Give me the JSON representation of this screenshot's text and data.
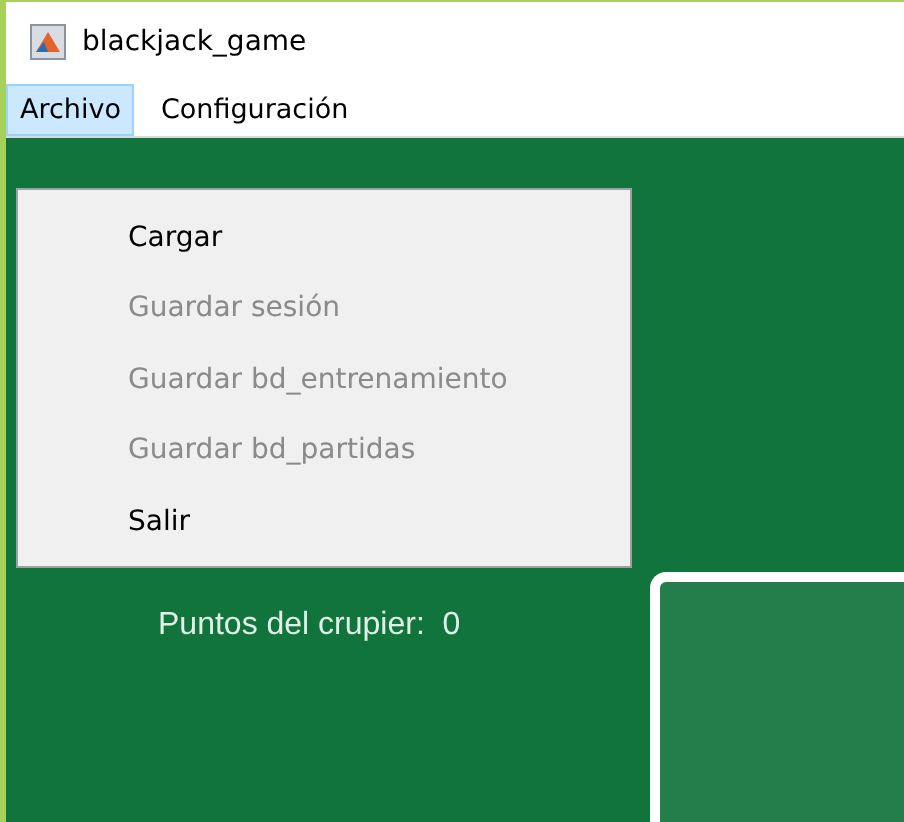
{
  "window": {
    "title": "blackjack_game"
  },
  "menu_bar": [
    {
      "label": "Archivo",
      "selected": true
    },
    {
      "label": "Configuración",
      "selected": false
    }
  ],
  "menu": {
    "items": [
      {
        "label": "Cargar",
        "disabled": false
      },
      {
        "label": "Guardar sesión",
        "disabled": true
      },
      {
        "label": "Guardar bd_entrenamiento",
        "disabled": true
      },
      {
        "label": "Guardar bd_partidas",
        "disabled": true
      },
      {
        "label": "Salir",
        "disabled": false
      }
    ]
  },
  "game": {
    "dealer_points_label": "Puntos del crupier:",
    "dealer_points": "0"
  }
}
